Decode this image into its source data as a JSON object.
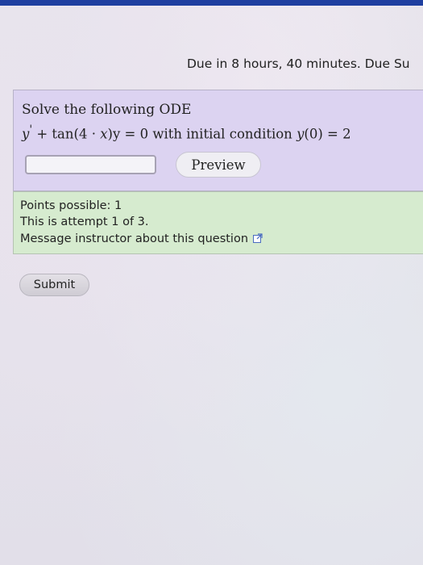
{
  "header": {
    "due_text": "Due in 8 hours, 40 minutes. Due Su"
  },
  "question": {
    "prompt": "Solve the following ODE",
    "equation": {
      "y_prime": "y",
      "prime_mark": "'",
      "plus_tan": " + tan(4 · ",
      "x_var": "x",
      "close_y": ")y",
      "equals_zero": " = 0",
      "with_text": " with initial condition ",
      "y_of": "y",
      "ic_rest": "(0) = 2"
    },
    "answer_value": "",
    "preview_label": "Preview"
  },
  "info": {
    "points": "Points possible: 1",
    "attempt": "This is attempt 1 of 3.",
    "message_link": "Message instructor about this question",
    "link_icon": "external-link-icon"
  },
  "submit_label": "Submit",
  "colors": {
    "question_bg": "#dcd3f1",
    "info_bg": "#d6ebcf",
    "top_bar": "#1f3fa0"
  }
}
